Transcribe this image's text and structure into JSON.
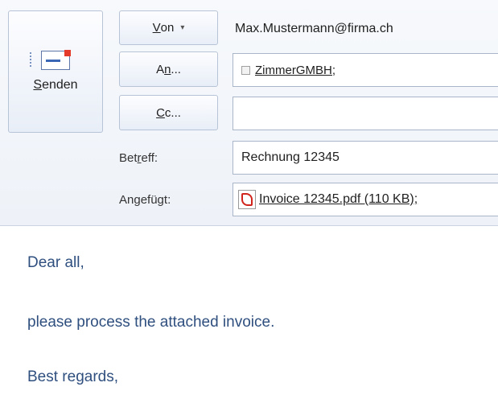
{
  "toolbar": {
    "send_label_accel": "S",
    "send_label_rest": "enden"
  },
  "from": {
    "button_accel": "V",
    "button_rest": "on",
    "caret": "▾",
    "address": "Max.Mustermann@firma.ch"
  },
  "to": {
    "button_pre": "A",
    "button_accel": "n",
    "button_post": "...",
    "recipients": "ZimmerGMBH;"
  },
  "cc": {
    "button_accel": "C",
    "button_post": "c...",
    "value": ""
  },
  "subject": {
    "label_pre": "Bet",
    "label_accel": "r",
    "label_post": "eff:",
    "value": "Rechnung 12345"
  },
  "attachment": {
    "label_pre": "An",
    "label_accel": "g",
    "label_post": "efügt:",
    "file": "Invoice 12345.pdf (110 KB);",
    "icon": "pdf-icon"
  },
  "message": {
    "line1": "Dear all,",
    "line2": "please process the attached invoice.",
    "line3": "Best regards,"
  },
  "colors": {
    "body_text": "#2f4f7f",
    "pdf_red": "#d0231b",
    "header_bg": "#eef2f8"
  }
}
